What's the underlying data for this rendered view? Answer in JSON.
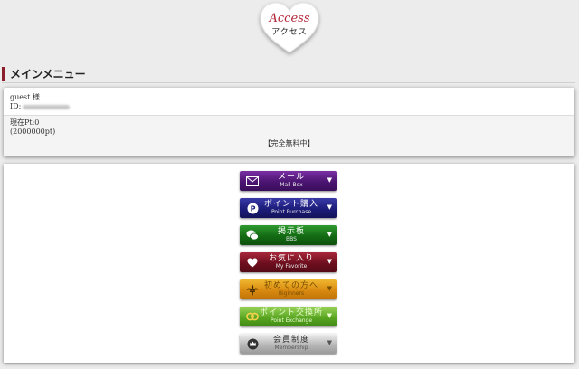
{
  "logo": {
    "title": "Access",
    "subtitle": "アクセス"
  },
  "section": {
    "heading": "メインメニュー"
  },
  "user": {
    "name_line": "guest 様",
    "id_label": "ID:",
    "points_line": "現在Pt:0",
    "points_sub": "(2000000pt)",
    "free_notice": "【完全無料中】"
  },
  "menu": {
    "items": [
      {
        "jp": "メール",
        "en": "Mail Box",
        "icon": "envelope-icon",
        "arrow": "▼"
      },
      {
        "jp": "ポイント購入",
        "en": "Point Purchase",
        "icon": "point-coin-icon",
        "arrow": "▼"
      },
      {
        "jp": "掲示板",
        "en": "BBS",
        "icon": "chat-bubbles-icon",
        "arrow": "▼"
      },
      {
        "jp": "お気に入り",
        "en": "My Favorite",
        "icon": "heart-icon",
        "arrow": "▼"
      },
      {
        "jp": "初めての方へ",
        "en": "Biginners",
        "icon": "fleur-de-lis-icon",
        "arrow": "▼"
      },
      {
        "jp": "ポイント交換所",
        "en": "Point Exchange",
        "icon": "rings-icon",
        "arrow": "▼"
      },
      {
        "jp": "会員制度",
        "en": "Membership",
        "icon": "crown-icon",
        "arrow": "▼"
      }
    ]
  },
  "colors": {
    "accent": "#b3263a",
    "heading_bar": "#8b1e2b"
  }
}
